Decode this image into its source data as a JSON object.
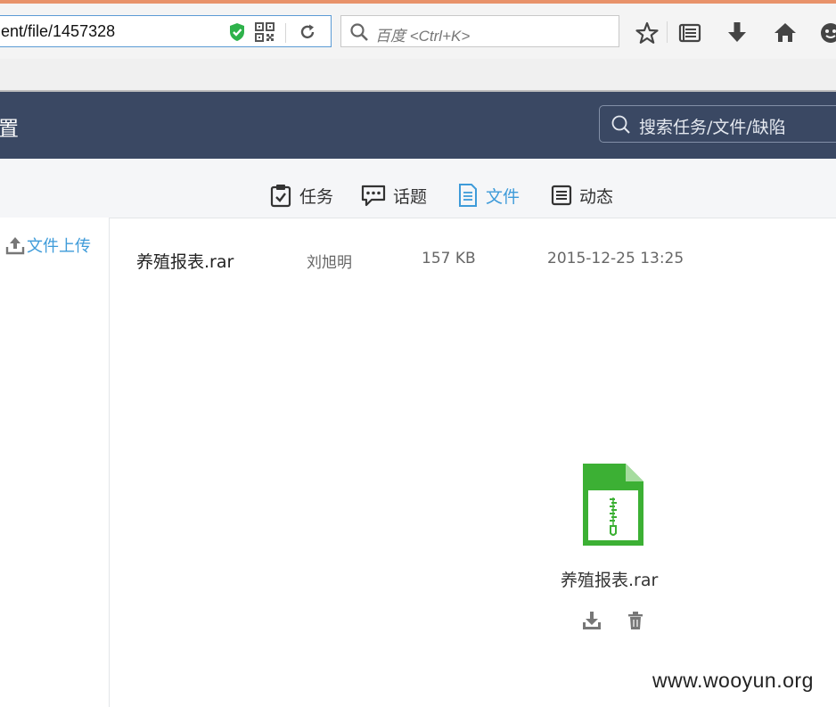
{
  "browser": {
    "url": "ent/file/1457328",
    "search_placeholder": "百度 <Ctrl+K>"
  },
  "header": {
    "title": "置",
    "search_placeholder": "搜索任务/文件/缺陷"
  },
  "tabs": [
    {
      "label": "任务",
      "icon": "clipboard-check-icon"
    },
    {
      "label": "话题",
      "icon": "chat-bubble-icon"
    },
    {
      "label": "文件",
      "icon": "document-icon",
      "active": true
    },
    {
      "label": "动态",
      "icon": "list-box-icon"
    }
  ],
  "sidebar": {
    "upload_label": "文件上传"
  },
  "file": {
    "name": "养殖报表.rar",
    "owner": "刘旭明",
    "size": "157 KB",
    "modified": "2015-12-25 13:25"
  },
  "preview": {
    "name": "养殖报表.rar",
    "icon": "zip-file-icon",
    "icon_color": "#3cb034"
  },
  "colors": {
    "header_bg": "#3a4863",
    "accent": "#3e9bd9"
  },
  "watermark": "www.wooyun.org"
}
